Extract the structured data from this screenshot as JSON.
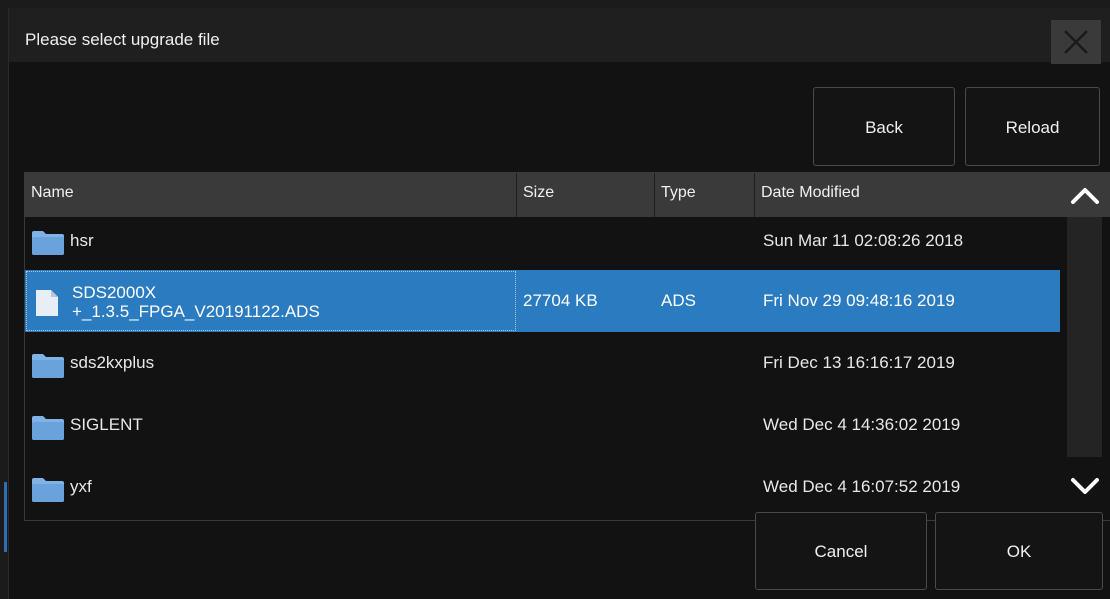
{
  "dialog": {
    "title": "Please select upgrade file",
    "buttons": {
      "back": "Back",
      "reload": "Reload",
      "cancel": "Cancel",
      "ok": "OK"
    }
  },
  "table": {
    "headers": {
      "name": "Name",
      "size": "Size",
      "type": "Type",
      "date": "Date Modified"
    },
    "rows": [
      {
        "kind": "folder",
        "name": "hsr",
        "size": "",
        "type": "",
        "date": "Sun Mar 11 02:08:26 2018",
        "selected": false
      },
      {
        "kind": "file",
        "name_line1": "SDS2000X",
        "name_line2": "+_1.3.5_FPGA_V20191122.ADS",
        "size": "27704 KB",
        "type": "ADS",
        "date": "Fri Nov 29 09:48:16 2019",
        "selected": true
      },
      {
        "kind": "folder",
        "name": "sds2kxplus",
        "size": "",
        "type": "",
        "date": "Fri Dec 13 16:16:17 2019",
        "selected": false
      },
      {
        "kind": "folder",
        "name": "SIGLENT",
        "size": "",
        "type": "",
        "date": "Wed Dec 4 14:36:02 2019",
        "selected": false
      },
      {
        "kind": "folder",
        "name": "yxf",
        "size": "",
        "type": "",
        "date": "Wed Dec 4 16:07:52 2019",
        "selected": false
      }
    ]
  },
  "icons": {
    "close": "close-icon",
    "folder": "folder-icon",
    "file": "file-icon",
    "up": "chevron-up-icon",
    "down": "chevron-down-icon"
  },
  "colors": {
    "selection": "#2b7bc0",
    "folder": "#7fb3e6",
    "header": "#3a3a3a",
    "background": "#121212"
  }
}
